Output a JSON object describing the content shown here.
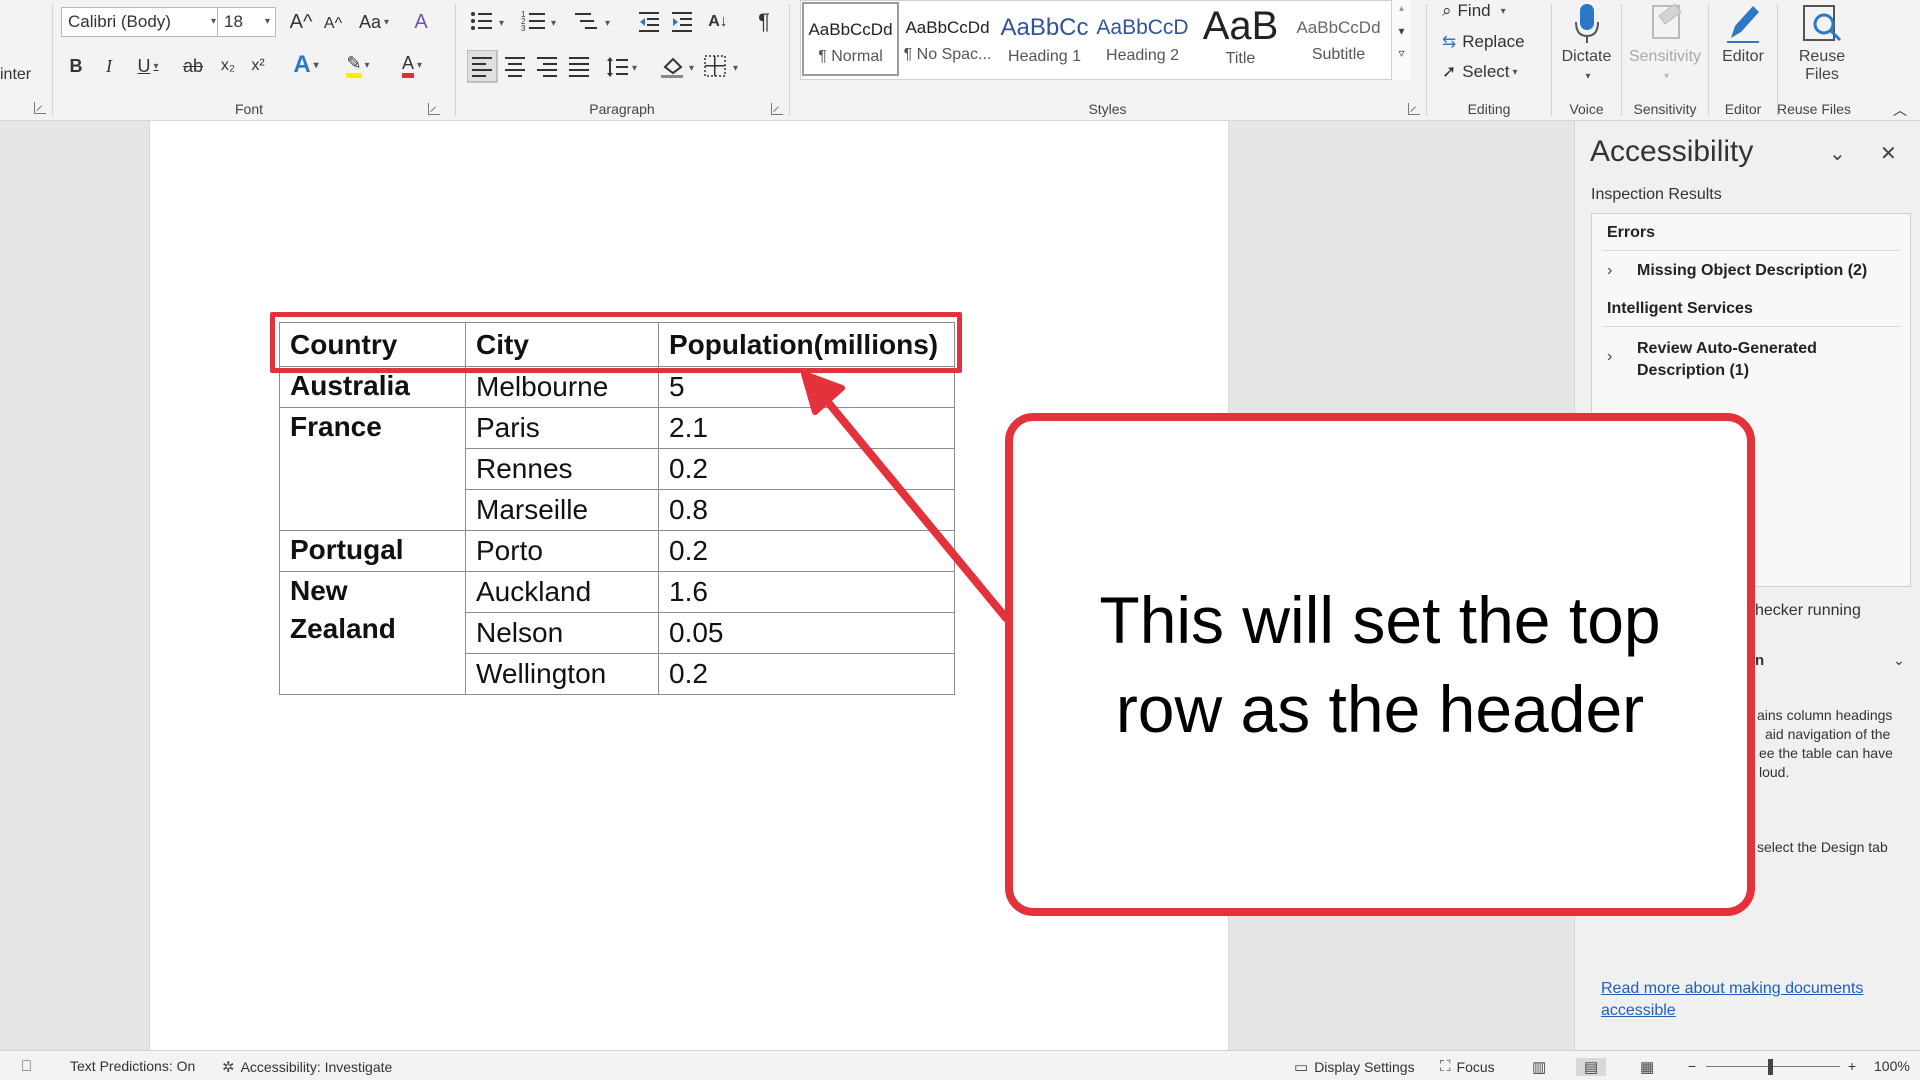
{
  "ribbon": {
    "clipboard_fragment": "inter",
    "font": {
      "label": "Font",
      "font_name": "Calibri (Body)",
      "font_size": "18",
      "grow": "A^",
      "shrink": "A^",
      "change_case": "Aa",
      "clear": "A",
      "bold": "B",
      "italic": "I",
      "underline": "U",
      "strike": "ab",
      "subscript": "x₂",
      "superscript": "x²",
      "effects": "A",
      "highlight": "✎",
      "color": "A",
      "highlight_color": "#ffee00",
      "font_color": "#e3323c"
    },
    "paragraph": {
      "label": "Paragraph",
      "pilcrow": "¶",
      "sort": "A↓"
    },
    "styles": {
      "label": "Styles",
      "items": [
        {
          "sample": "AaBbCcDd",
          "name": "¶ Normal"
        },
        {
          "sample": "AaBbCcDd",
          "name": "¶ No Spac..."
        },
        {
          "sample": "AaBbCc",
          "name": "Heading 1"
        },
        {
          "sample": "AaBbCcD",
          "name": "Heading 2"
        },
        {
          "sample": "AaB",
          "name": "Title"
        },
        {
          "sample": "AaBbCcDd",
          "name": "Subtitle"
        }
      ]
    },
    "editing": {
      "label": "Editing",
      "find": "Find",
      "replace": "Replace",
      "select": "Select"
    },
    "voice": {
      "label": "Voice",
      "dictate": "Dictate"
    },
    "sensitivity": {
      "label": "Sensitivity",
      "button": "Sensitivity"
    },
    "editor": {
      "label": "Editor",
      "button": "Editor"
    },
    "reuse": {
      "label": "Reuse Files",
      "button_line1": "Reuse",
      "button_line2": "Files"
    }
  },
  "table": {
    "headers": [
      "Country",
      "City",
      "Population(millions)"
    ],
    "countries": [
      "Australia",
      "France",
      "Portugal",
      "New Zealand"
    ],
    "rows": [
      {
        "city": "Melbourne",
        "pop": "5"
      },
      {
        "city": "Paris",
        "pop": "2.1"
      },
      {
        "city": "Rennes",
        "pop": "0.2"
      },
      {
        "city": "Marseille",
        "pop": "0.8"
      },
      {
        "city": "Porto",
        "pop": "0.2"
      },
      {
        "city": "Auckland",
        "pop": "1.6"
      },
      {
        "city": "Nelson",
        "pop": "0.05"
      },
      {
        "city": "Wellington",
        "pop": "0.2"
      }
    ]
  },
  "callout": {
    "text": "This will set the top row as the header",
    "accent": "#e3323c"
  },
  "pane": {
    "title": "Accessibility",
    "subtitle": "Inspection Results",
    "errors_heading": "Errors",
    "error_item": "Missing Object Description (2)",
    "services_heading": "Intelligent Services",
    "service_item_line1": "Review Auto-Generated",
    "service_item_line2": "Description (1)",
    "frag_checker": "hecker running",
    "frag_n": "n",
    "frag_1": "ains column headings",
    "frag_2": "aid navigation of the",
    "frag_3": "ee the table can have",
    "frag_4": "loud.",
    "frag_5": "select the Design tab",
    "link_line1": "Read more about making documents",
    "link_line2": "accessible"
  },
  "status": {
    "text_predictions": "Text Predictions: On",
    "accessibility": "Accessibility: Investigate",
    "display_settings": "Display Settings",
    "focus": "Focus",
    "zoom_level": "100%",
    "zoom_fraction": 0.48
  }
}
